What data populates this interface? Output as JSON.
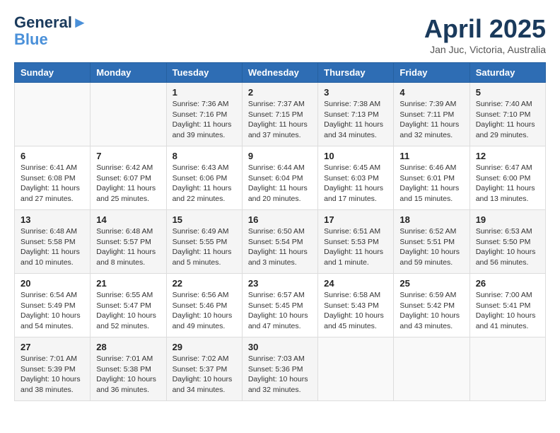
{
  "header": {
    "logo_line1": "General",
    "logo_line2": "Blue",
    "month": "April 2025",
    "location": "Jan Juc, Victoria, Australia"
  },
  "weekdays": [
    "Sunday",
    "Monday",
    "Tuesday",
    "Wednesday",
    "Thursday",
    "Friday",
    "Saturday"
  ],
  "weeks": [
    [
      {
        "day": "",
        "info": ""
      },
      {
        "day": "",
        "info": ""
      },
      {
        "day": "1",
        "info": "Sunrise: 7:36 AM\nSunset: 7:16 PM\nDaylight: 11 hours\nand 39 minutes."
      },
      {
        "day": "2",
        "info": "Sunrise: 7:37 AM\nSunset: 7:15 PM\nDaylight: 11 hours\nand 37 minutes."
      },
      {
        "day": "3",
        "info": "Sunrise: 7:38 AM\nSunset: 7:13 PM\nDaylight: 11 hours\nand 34 minutes."
      },
      {
        "day": "4",
        "info": "Sunrise: 7:39 AM\nSunset: 7:11 PM\nDaylight: 11 hours\nand 32 minutes."
      },
      {
        "day": "5",
        "info": "Sunrise: 7:40 AM\nSunset: 7:10 PM\nDaylight: 11 hours\nand 29 minutes."
      }
    ],
    [
      {
        "day": "6",
        "info": "Sunrise: 6:41 AM\nSunset: 6:08 PM\nDaylight: 11 hours\nand 27 minutes."
      },
      {
        "day": "7",
        "info": "Sunrise: 6:42 AM\nSunset: 6:07 PM\nDaylight: 11 hours\nand 25 minutes."
      },
      {
        "day": "8",
        "info": "Sunrise: 6:43 AM\nSunset: 6:06 PM\nDaylight: 11 hours\nand 22 minutes."
      },
      {
        "day": "9",
        "info": "Sunrise: 6:44 AM\nSunset: 6:04 PM\nDaylight: 11 hours\nand 20 minutes."
      },
      {
        "day": "10",
        "info": "Sunrise: 6:45 AM\nSunset: 6:03 PM\nDaylight: 11 hours\nand 17 minutes."
      },
      {
        "day": "11",
        "info": "Sunrise: 6:46 AM\nSunset: 6:01 PM\nDaylight: 11 hours\nand 15 minutes."
      },
      {
        "day": "12",
        "info": "Sunrise: 6:47 AM\nSunset: 6:00 PM\nDaylight: 11 hours\nand 13 minutes."
      }
    ],
    [
      {
        "day": "13",
        "info": "Sunrise: 6:48 AM\nSunset: 5:58 PM\nDaylight: 11 hours\nand 10 minutes."
      },
      {
        "day": "14",
        "info": "Sunrise: 6:48 AM\nSunset: 5:57 PM\nDaylight: 11 hours\nand 8 minutes."
      },
      {
        "day": "15",
        "info": "Sunrise: 6:49 AM\nSunset: 5:55 PM\nDaylight: 11 hours\nand 5 minutes."
      },
      {
        "day": "16",
        "info": "Sunrise: 6:50 AM\nSunset: 5:54 PM\nDaylight: 11 hours\nand 3 minutes."
      },
      {
        "day": "17",
        "info": "Sunrise: 6:51 AM\nSunset: 5:53 PM\nDaylight: 11 hours\nand 1 minute."
      },
      {
        "day": "18",
        "info": "Sunrise: 6:52 AM\nSunset: 5:51 PM\nDaylight: 10 hours\nand 59 minutes."
      },
      {
        "day": "19",
        "info": "Sunrise: 6:53 AM\nSunset: 5:50 PM\nDaylight: 10 hours\nand 56 minutes."
      }
    ],
    [
      {
        "day": "20",
        "info": "Sunrise: 6:54 AM\nSunset: 5:49 PM\nDaylight: 10 hours\nand 54 minutes."
      },
      {
        "day": "21",
        "info": "Sunrise: 6:55 AM\nSunset: 5:47 PM\nDaylight: 10 hours\nand 52 minutes."
      },
      {
        "day": "22",
        "info": "Sunrise: 6:56 AM\nSunset: 5:46 PM\nDaylight: 10 hours\nand 49 minutes."
      },
      {
        "day": "23",
        "info": "Sunrise: 6:57 AM\nSunset: 5:45 PM\nDaylight: 10 hours\nand 47 minutes."
      },
      {
        "day": "24",
        "info": "Sunrise: 6:58 AM\nSunset: 5:43 PM\nDaylight: 10 hours\nand 45 minutes."
      },
      {
        "day": "25",
        "info": "Sunrise: 6:59 AM\nSunset: 5:42 PM\nDaylight: 10 hours\nand 43 minutes."
      },
      {
        "day": "26",
        "info": "Sunrise: 7:00 AM\nSunset: 5:41 PM\nDaylight: 10 hours\nand 41 minutes."
      }
    ],
    [
      {
        "day": "27",
        "info": "Sunrise: 7:01 AM\nSunset: 5:39 PM\nDaylight: 10 hours\nand 38 minutes."
      },
      {
        "day": "28",
        "info": "Sunrise: 7:01 AM\nSunset: 5:38 PM\nDaylight: 10 hours\nand 36 minutes."
      },
      {
        "day": "29",
        "info": "Sunrise: 7:02 AM\nSunset: 5:37 PM\nDaylight: 10 hours\nand 34 minutes."
      },
      {
        "day": "30",
        "info": "Sunrise: 7:03 AM\nSunset: 5:36 PM\nDaylight: 10 hours\nand 32 minutes."
      },
      {
        "day": "",
        "info": ""
      },
      {
        "day": "",
        "info": ""
      },
      {
        "day": "",
        "info": ""
      }
    ]
  ]
}
